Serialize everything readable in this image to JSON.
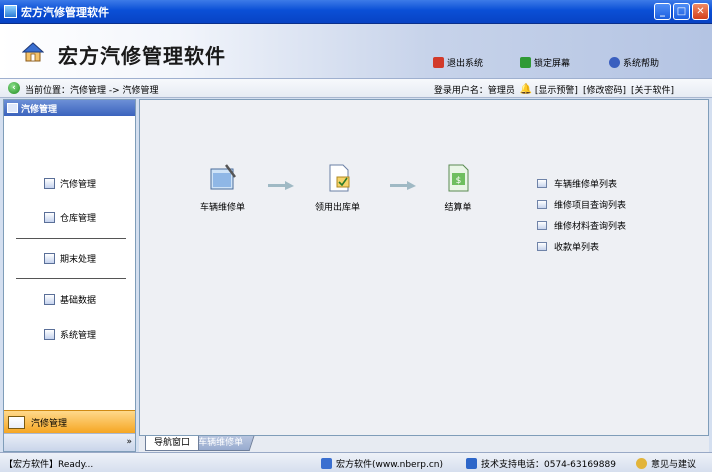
{
  "window": {
    "title": "宏方汽修管理软件",
    "controls": [
      "_",
      "□",
      "✕"
    ]
  },
  "header": {
    "app_name": "宏方汽修管理软件",
    "buttons": [
      {
        "label": "退出系统",
        "icon": "exit-icon",
        "color": "#d23a2a"
      },
      {
        "label": "锁定屏幕",
        "icon": "lock-screen-icon",
        "color": "#2f9a35"
      },
      {
        "label": "系统帮助",
        "icon": "help-icon",
        "color": "#3a5fbf"
      }
    ]
  },
  "location": {
    "text": "当前位置：汽修管理 -> 汽修管理",
    "login_label": "登录用户名：管理员",
    "links": [
      "[显示预警]",
      "[修改密码]",
      "[关于软件]"
    ]
  },
  "sidebar": {
    "title": "汽修管理",
    "items": [
      {
        "label": "汽修管理",
        "icon": "car-repair-icon"
      },
      {
        "label": "仓库管理",
        "icon": "warehouse-icon"
      },
      {
        "label": "期末处理",
        "icon": "period-end-icon"
      },
      {
        "label": "基础数据",
        "icon": "base-data-icon"
      },
      {
        "label": "系统管理",
        "icon": "system-icon"
      }
    ],
    "bottom_label": "汽修管理",
    "footer_glyph": "»"
  },
  "main": {
    "flow": [
      {
        "label": "车辆维修单",
        "icon": "repair-order-icon"
      },
      {
        "label": "领用出库单",
        "icon": "stock-out-icon"
      },
      {
        "label": "结算单",
        "icon": "settlement-icon"
      }
    ],
    "links": [
      "车辆维修单列表",
      "维修项目查询列表",
      "维修材料查询列表",
      "收款单列表"
    ]
  },
  "tabs": [
    {
      "label": "导航窗口",
      "active": true
    },
    {
      "label": "车辆维修单",
      "active": false
    }
  ],
  "statusbar": {
    "left": "【宏方软件】Ready...",
    "company": "宏方软件(www.nberp.cn)",
    "phone": "技术支持电话：0574-63169889",
    "feedback": "意见与建议"
  }
}
